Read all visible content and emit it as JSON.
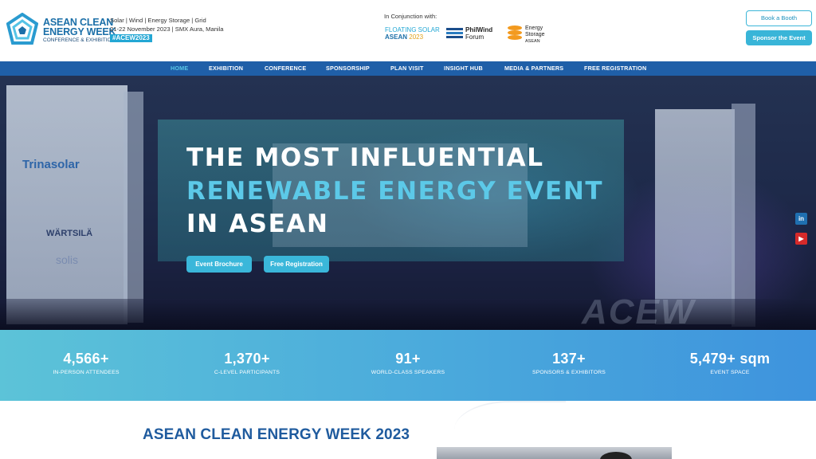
{
  "header": {
    "brand_line1": "ASEAN CLEAN",
    "brand_line2": "ENERGY WEEK",
    "brand_sub": "CONFERENCE & EXHIBITION",
    "tagline": "Solar | Wind | Energy Storage | Grid",
    "date_venue": "21-22 November 2023 | SMX Aura, Manila",
    "hashtag": "#ACEW2023",
    "conjunction_label": "In Conjunction with:",
    "partners": {
      "floating_solar_line1": "FLOATING SOLAR",
      "floating_solar_line2": "ASEAN",
      "floating_solar_year": "2023",
      "philwind_line1": "PhilWind",
      "philwind_line2": "Forum",
      "energy_storage_line1": "Energy",
      "energy_storage_line2": "Storage",
      "energy_storage_line3": "ASEAN"
    },
    "book_booth_label": "Book a Booth",
    "sponsor_label": "Sponsor the Event"
  },
  "nav": {
    "items": [
      "HOME",
      "EXHIBITION",
      "CONFERENCE",
      "SPONSORSHIP",
      "PLAN VISIT",
      "INSIGHT HUB",
      "MEDIA & PARTNERS",
      "FREE REGISTRATION"
    ],
    "active": "HOME"
  },
  "hero": {
    "headline_line1": "THE MOST INFLUENTIAL",
    "headline_line2": "RENEWABLE ENERGY EVENT",
    "headline_line3": "IN ASEAN",
    "brochure_label": "Event Brochure",
    "registration_label": "Free Registration",
    "backdrop_texts": {
      "trina": "Trinasolar",
      "wartsila": "WÄRTSILÄ",
      "solis": "solis",
      "acew": "ACEW"
    }
  },
  "social": {
    "linkedin": "in",
    "youtube": "▶"
  },
  "stats": [
    {
      "value": "4,566+",
      "label": "IN-PERSON ATTENDEES"
    },
    {
      "value": "1,370+",
      "label": "C-LEVEL PARTICIPANTS"
    },
    {
      "value": "91+",
      "label": "WORLD-CLASS SPEAKERS"
    },
    {
      "value": "137+",
      "label": "SPONSORS & EXHIBITORS"
    },
    {
      "value": "5,479+ sqm",
      "label": "EVENT SPACE"
    }
  ],
  "about": {
    "title": "ASEAN CLEAN ENERGY WEEK 2023"
  },
  "colors": {
    "brand_blue": "#1f5fa8",
    "accent_cyan": "#39b5d8",
    "headline_cyan": "#5cc9e8"
  }
}
